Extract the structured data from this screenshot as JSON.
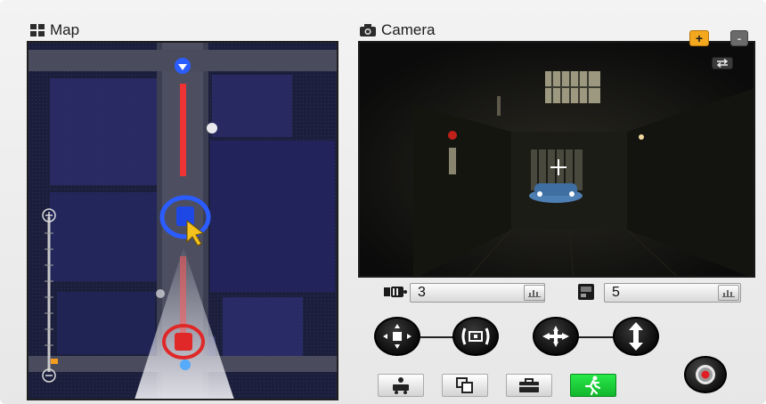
{
  "map_panel": {
    "title": "Map",
    "icon": "grid-icon",
    "zoom_level": 0.05
  },
  "camera_panel": {
    "title": "Camera",
    "icon": "camera-icon",
    "zoom_in_label": "+",
    "zoom_out_label": "-",
    "swap_icon": "swap-icon"
  },
  "counters": [
    {
      "name": "film-counter",
      "icon": "film-icon",
      "value": "3",
      "button_icon": "bar-chart-icon"
    },
    {
      "name": "photo-counter",
      "icon": "photo-icon",
      "value": "5",
      "button_icon": "bar-chart-icon"
    }
  ],
  "controls": {
    "move": "move-icon",
    "frame": "frame-icon",
    "plane": "plane-icon",
    "vertical": "vertical-arrow-icon",
    "action_buttons": [
      "person-cart-icon",
      "copy-icon",
      "toolbox-icon",
      "running-man-icon"
    ],
    "active_action": "running-man-icon",
    "record": "record-icon"
  },
  "colors": {
    "accent_orange": "#f3a81e",
    "active_green": "#1ccf3b",
    "blue_marker": "#2a5cff",
    "red_marker": "#e02828"
  }
}
